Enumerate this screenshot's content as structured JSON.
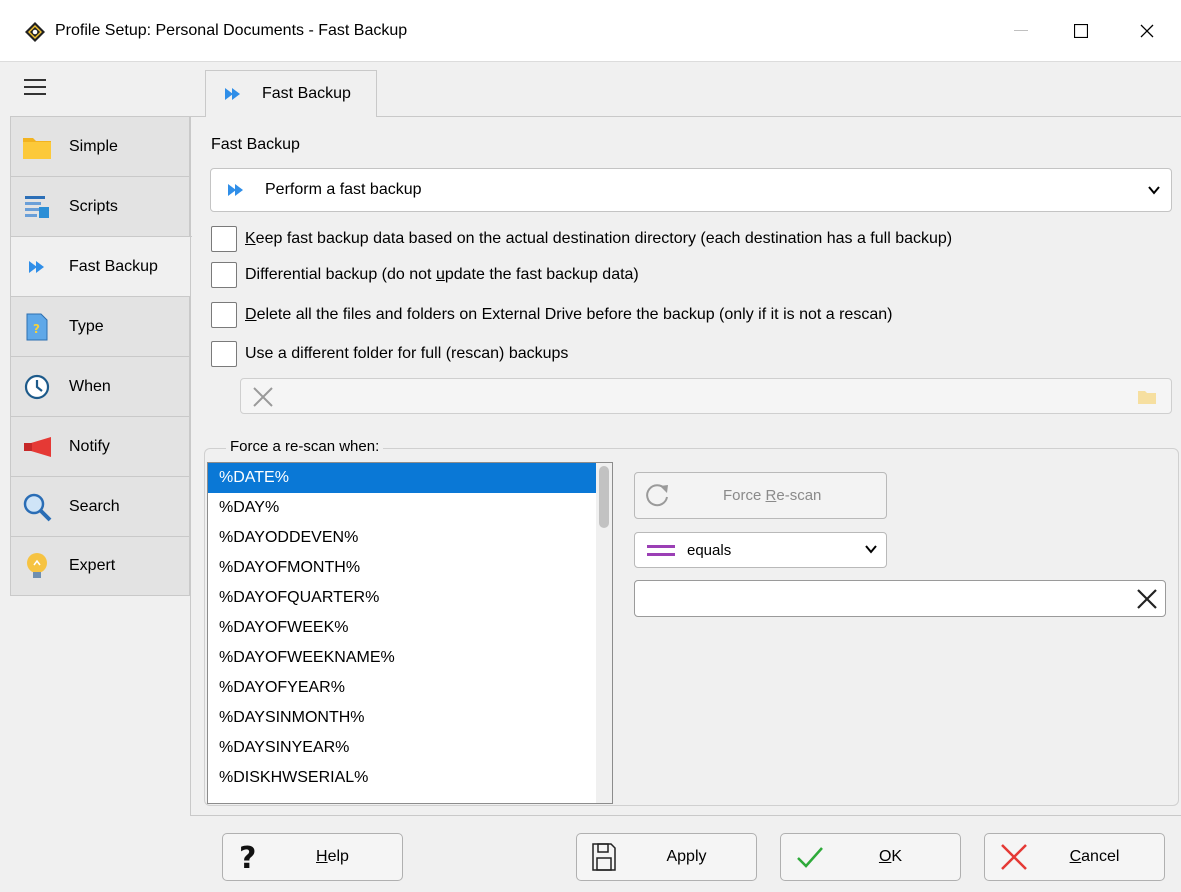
{
  "window": {
    "title": "Profile Setup: Personal Documents - Fast Backup",
    "minimize": "—",
    "maximize": "☐",
    "close": "✕"
  },
  "sidebar": {
    "items": [
      {
        "label": "Simple",
        "icon": "folder-icon"
      },
      {
        "label": "Scripts",
        "icon": "scripts-icon"
      },
      {
        "label": "Fast Backup",
        "icon": "fast-forward-icon"
      },
      {
        "label": "Type",
        "icon": "help-file-icon"
      },
      {
        "label": "When",
        "icon": "clock-icon"
      },
      {
        "label": "Notify",
        "icon": "megaphone-icon"
      },
      {
        "label": "Search",
        "icon": "magnifier-icon"
      },
      {
        "label": "Expert",
        "icon": "lightbulb-icon"
      }
    ],
    "active_index": 2
  },
  "tab": {
    "label": "Fast Backup"
  },
  "fast_backup": {
    "section_label": "Fast Backup",
    "mode_value": "Perform a fast backup"
  },
  "checkboxes": [
    {
      "pre": "",
      "u": "K",
      "post": "eep fast backup data based on the actual destination directory (each destination has a full backup)",
      "checked": false
    },
    {
      "pre": "Differential backup (do not ",
      "u": "u",
      "post": "pdate the fast backup data)",
      "checked": false
    },
    {
      "pre": "",
      "u": "D",
      "post": "elete all the files and folders on External Drive before the backup (only if it is not a rescan)",
      "checked": false
    },
    {
      "pre": "Use a different folder for full (rescan) backups",
      "u": "",
      "post": "",
      "checked": false
    }
  ],
  "rescan": {
    "legend": "Force a re-scan when:",
    "variables": [
      "%DATE%",
      "%DAY%",
      "%DAYODDEVEN%",
      "%DAYOFMONTH%",
      "%DAYOFQUARTER%",
      "%DAYOFWEEK%",
      "%DAYOFWEEKNAME%",
      "%DAYOFYEAR%",
      "%DAYSINMONTH%",
      "%DAYSINYEAR%",
      "%DISKHWSERIAL%"
    ],
    "selected_index": 0,
    "button_pre": "Force ",
    "button_u": "R",
    "button_post": "e-scan",
    "operator": "equals",
    "value": ""
  },
  "buttons": {
    "help": {
      "u": "H",
      "rest": "elp"
    },
    "apply": {
      "u": "",
      "rest": "Apply"
    },
    "ok": {
      "u": "O",
      "rest": "K"
    },
    "cancel": {
      "u": "C",
      "rest": "ancel"
    }
  },
  "colors": {
    "accent": "#0a78d6",
    "fast_forward": "#2f8ee8",
    "equals_purple": "#9b3fb5",
    "ok_green": "#2eaa3a",
    "cancel_red": "#e53935"
  }
}
